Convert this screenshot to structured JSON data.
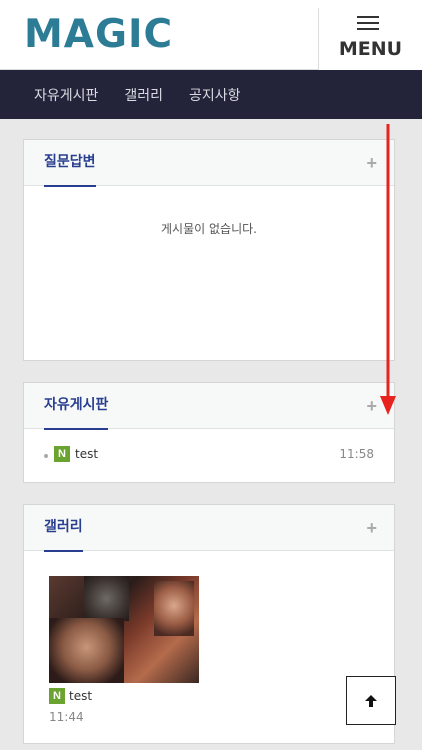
{
  "header": {
    "logo_text": "MAGIC",
    "menu_label": "MENU",
    "menu_icon": "hamburger-icon"
  },
  "nav": {
    "items": [
      {
        "label": "자유게시판"
      },
      {
        "label": "갤러리"
      },
      {
        "label": "공지사항"
      }
    ]
  },
  "panels": {
    "qna": {
      "title": "질문답변",
      "more_icon": "plus-icon",
      "empty_text": "게시물이 없습니다."
    },
    "free_board": {
      "title": "자유게시판",
      "more_icon": "plus-icon",
      "posts": [
        {
          "badge": "N",
          "title": "test",
          "time": "11:58"
        }
      ]
    },
    "gallery": {
      "title": "갤러리",
      "more_icon": "plus-icon",
      "items": [
        {
          "badge": "N",
          "title": "test",
          "time": "11:44"
        }
      ]
    }
  },
  "scroll_to_top": {
    "icon": "arrow-up-icon"
  },
  "colors": {
    "logo": "#2c7c96",
    "nav_bg": "#23243a",
    "panel_title": "#2a3e8f",
    "new_badge": "#6aa32f",
    "scroll_annotation": "#e8221f"
  }
}
